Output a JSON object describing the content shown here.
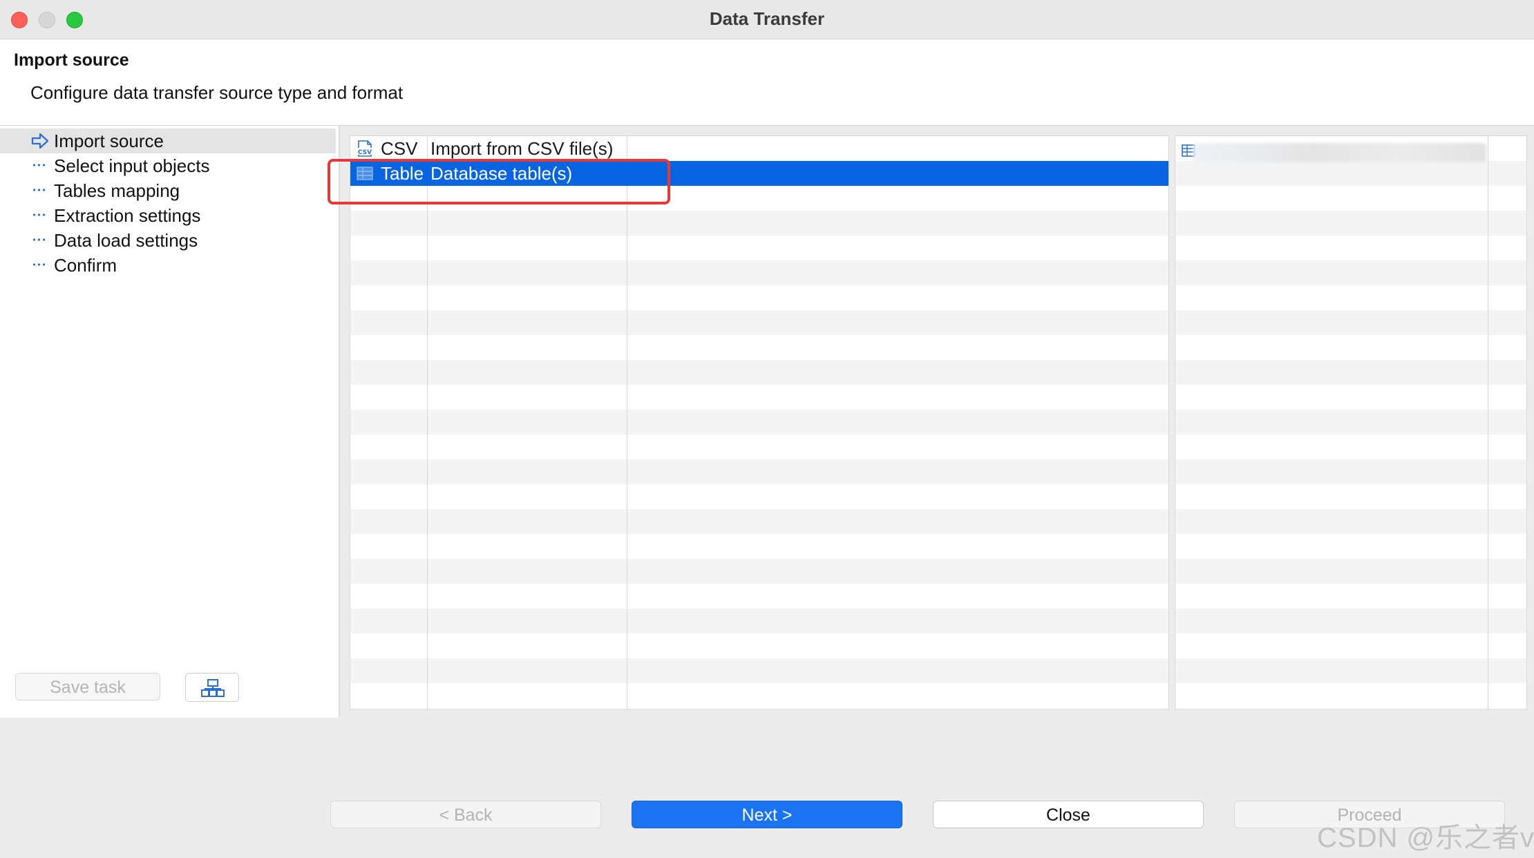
{
  "window": {
    "title": "Data Transfer"
  },
  "header": {
    "title": "Import source",
    "description": "Configure data transfer source type and format"
  },
  "nav": {
    "items": [
      {
        "label": "Import source",
        "icon": "arrow-right-icon",
        "active": true
      },
      {
        "label": "Select input objects",
        "icon": "dots-icon"
      },
      {
        "label": "Tables mapping",
        "icon": "dots-icon"
      },
      {
        "label": "Extraction settings",
        "icon": "dots-icon"
      },
      {
        "label": "Data load settings",
        "icon": "dots-icon"
      },
      {
        "label": "Confirm",
        "icon": "dots-icon"
      }
    ],
    "save_task_label": "Save task"
  },
  "sources": {
    "rows": [
      {
        "name": "CSV",
        "description": "Import from CSV file(s)",
        "icon": "csv-file-icon",
        "selected": false
      },
      {
        "name": "Table",
        "description": "Database table(s)",
        "icon": "table-icon",
        "selected": true
      }
    ]
  },
  "footer": {
    "back_label": "< Back",
    "next_label": "Next >",
    "close_label": "Close",
    "proceed_label": "Proceed"
  },
  "watermark": "CSDN @乐之者v",
  "colors": {
    "selection": "#0864e0",
    "primary_button": "#1a73f0",
    "highlight_border": "#e53935",
    "accent_icon": "#2a6fd6"
  }
}
